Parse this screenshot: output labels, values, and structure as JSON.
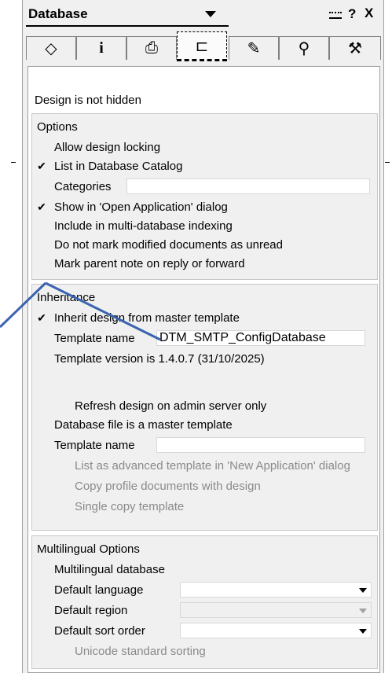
{
  "header": {
    "title": "Database",
    "help": "?",
    "close": "X"
  },
  "tabs": [
    {
      "icon": "basics-icon",
      "glyph": "◇"
    },
    {
      "icon": "info-icon",
      "glyph": "i"
    },
    {
      "icon": "print-icon",
      "glyph": "⎙"
    },
    {
      "icon": "design-icon",
      "glyph": "⊏"
    },
    {
      "icon": "launch-icon",
      "glyph": "✎"
    },
    {
      "icon": "search-index-icon",
      "glyph": "⚲"
    },
    {
      "icon": "advanced-icon",
      "glyph": "⚒"
    }
  ],
  "status": "Design is not hidden",
  "options": {
    "title": "Options",
    "allow_design_locking": {
      "label": "Allow design locking",
      "checked": false
    },
    "list_in_catalog": {
      "label": "List in Database Catalog",
      "checked": true
    },
    "categories_label": "Categories",
    "categories_value": "",
    "show_in_open_app": {
      "label": "Show in 'Open Application' dialog",
      "checked": true
    },
    "multi_db_indexing": {
      "label": "Include in multi-database indexing",
      "checked": false
    },
    "do_not_mark_unread": {
      "label": "Do not mark modified documents as unread",
      "checked": false
    },
    "mark_parent_note": {
      "label": "Mark parent note on reply or forward",
      "checked": false
    }
  },
  "inheritance": {
    "title": "Inheritance",
    "inherit_design": {
      "label": "Inherit design from master template",
      "checked": true
    },
    "template_name_label": "Template name",
    "template_name_value": "DTM_SMTP_ConfigDatabase",
    "template_version": "Template version is 1.4.0.7 (31/10/2025)",
    "refresh_design": {
      "label": "Refresh design on admin server only",
      "checked": false
    },
    "is_master_template": {
      "label": "Database file is a master template",
      "checked": false
    },
    "master_template_name_label": "Template name",
    "master_template_name_value": "",
    "list_as_advanced": {
      "label": "List as advanced template in 'New Application' dialog",
      "checked": false
    },
    "copy_profile_docs": {
      "label": "Copy profile documents with design",
      "checked": false
    },
    "single_copy": {
      "label": "Single copy template",
      "checked": false
    }
  },
  "multilingual": {
    "title": "Multilingual Options",
    "multilingual_db": {
      "label": "Multilingual database",
      "checked": false
    },
    "default_language_label": "Default language",
    "default_language_value": "",
    "default_region_label": "Default region",
    "default_region_value": "",
    "default_sort_label": "Default sort order",
    "default_sort_value": "",
    "unicode_sorting": {
      "label": "Unicode standard sorting",
      "checked": false
    }
  },
  "colors": {
    "panel_bg": "#f0f0f0",
    "annotation_arrow": "#3b63b0"
  }
}
